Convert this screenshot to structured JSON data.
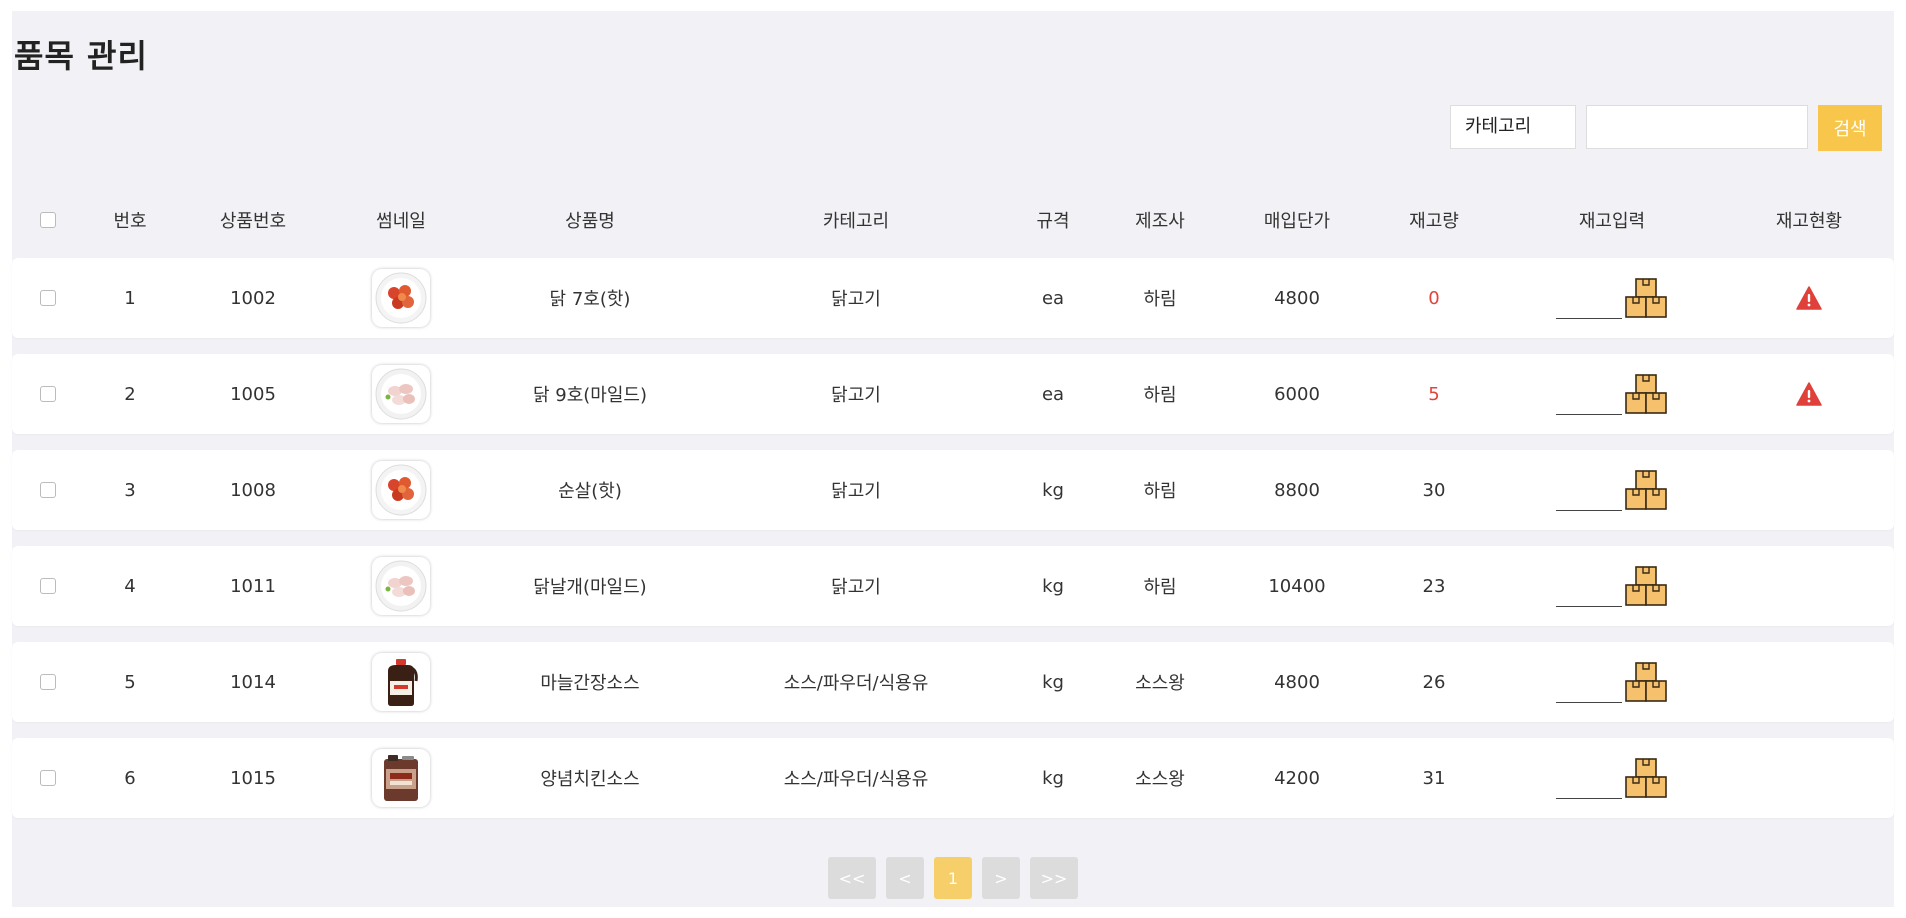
{
  "title": "품목 관리",
  "search": {
    "select_value": "카테고리",
    "input_value": "",
    "button_label": "검색"
  },
  "columns": [
    "번호",
    "상품번호",
    "썸네일",
    "상품명",
    "카테고리",
    "규격",
    "제조사",
    "매입단가",
    "재고량",
    "재고입력",
    "재고현황"
  ],
  "rows": [
    {
      "no": "1",
      "product_no": "1002",
      "thumb": "chicken-red",
      "name": "닭 7호(핫)",
      "category": "닭고기",
      "spec": "ea",
      "maker": "하림",
      "price": "4800",
      "stock": "0",
      "low": true,
      "warning": true
    },
    {
      "no": "2",
      "product_no": "1005",
      "thumb": "chicken-raw",
      "name": "닭 9호(마일드)",
      "category": "닭고기",
      "spec": "ea",
      "maker": "하림",
      "price": "6000",
      "stock": "5",
      "low": true,
      "warning": true
    },
    {
      "no": "3",
      "product_no": "1008",
      "thumb": "chicken-red",
      "name": "순살(핫)",
      "category": "닭고기",
      "spec": "kg",
      "maker": "하림",
      "price": "8800",
      "stock": "30",
      "low": false,
      "warning": false
    },
    {
      "no": "4",
      "product_no": "1011",
      "thumb": "chicken-raw",
      "name": "닭날개(마일드)",
      "category": "닭고기",
      "spec": "kg",
      "maker": "하림",
      "price": "10400",
      "stock": "23",
      "low": false,
      "warning": false
    },
    {
      "no": "5",
      "product_no": "1014",
      "thumb": "sauce-bottle",
      "name": "마늘간장소스",
      "category": "소스/파우더/식용유",
      "spec": "kg",
      "maker": "소스왕",
      "price": "4800",
      "stock": "26",
      "low": false,
      "warning": false
    },
    {
      "no": "6",
      "product_no": "1015",
      "thumb": "sauce-canister",
      "name": "양념치킨소스",
      "category": "소스/파우더/식용유",
      "spec": "kg",
      "maker": "소스왕",
      "price": "4200",
      "stock": "31",
      "low": false,
      "warning": false
    }
  ],
  "pagination": {
    "first": "<<",
    "prev": "<",
    "current": "1",
    "next": ">",
    "last": ">>"
  },
  "colors": {
    "accent": "#f7c64a",
    "low_stock": "#e2433b",
    "warning": "#e0403a",
    "page_background": "#f2f2f6",
    "box_icon": "#f5c16c"
  },
  "icons": {
    "stock_input": "box-icon",
    "stock_status": "warning-icon"
  }
}
